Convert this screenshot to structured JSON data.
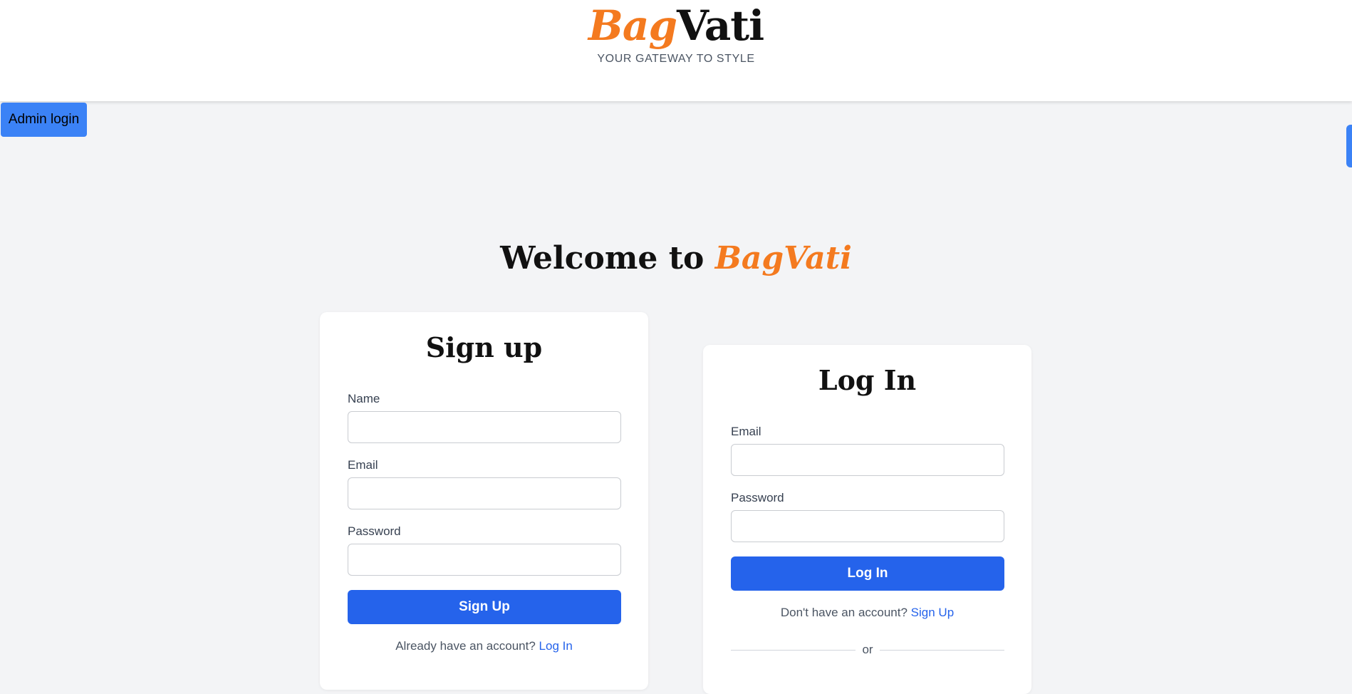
{
  "header": {
    "logo_part1": "Bag",
    "logo_part2": "Vati",
    "tagline": "YOUR GATEWAY TO STYLE"
  },
  "admin_button": "Admin login",
  "welcome": {
    "prefix": "Welcome to ",
    "brand": "BagVati"
  },
  "signup": {
    "title": "Sign up",
    "name_label": "Name",
    "name_value": "",
    "email_label": "Email",
    "email_value": "",
    "password_label": "Password",
    "password_value": "",
    "submit": "Sign Up",
    "switch_text": "Already have an account?",
    "switch_link": "Log In"
  },
  "login": {
    "title": "Log In",
    "email_label": "Email",
    "email_value": "",
    "password_label": "Password",
    "password_value": "",
    "submit": "Log In",
    "switch_text": "Don't have an account?",
    "switch_link": "Sign Up",
    "divider": "or"
  },
  "colors": {
    "accent_orange": "#f47a1f",
    "primary_blue": "#2563eb",
    "admin_blue": "#3b82f6",
    "background": "#f3f4f6"
  }
}
